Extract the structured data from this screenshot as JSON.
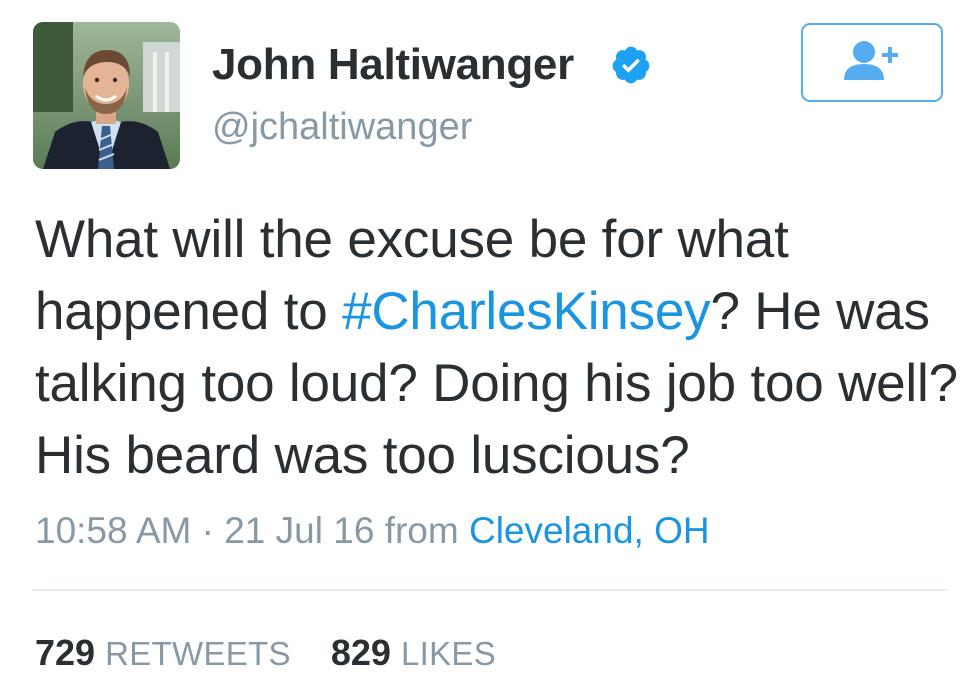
{
  "user": {
    "display_name": "John Haltiwanger",
    "handle": "@jchaltiwanger",
    "verified": true,
    "avatar_icon": "profile-photo"
  },
  "follow_button": {
    "icon": "follow-user-plus-icon",
    "color": "#55acee"
  },
  "tweet": {
    "text_before": "What will the excuse be for what happened to ",
    "hashtag": "#CharlesKinsey",
    "text_after": "? He was talking too loud? Doing his job too well? His beard was too luscious?"
  },
  "meta": {
    "time": "10:58 AM",
    "separator": " · ",
    "date": "21 Jul 16",
    "from_label": "from",
    "location": "Cleveland, OH"
  },
  "stats": {
    "retweets_count": "729",
    "retweets_label": "RETWEETS",
    "likes_count": "829",
    "likes_label": "LIKES"
  },
  "colors": {
    "text": "#292f33",
    "muted": "#8899a6",
    "link": "#1b95e0",
    "accent": "#55acee",
    "divider": "#e6ecf0"
  }
}
